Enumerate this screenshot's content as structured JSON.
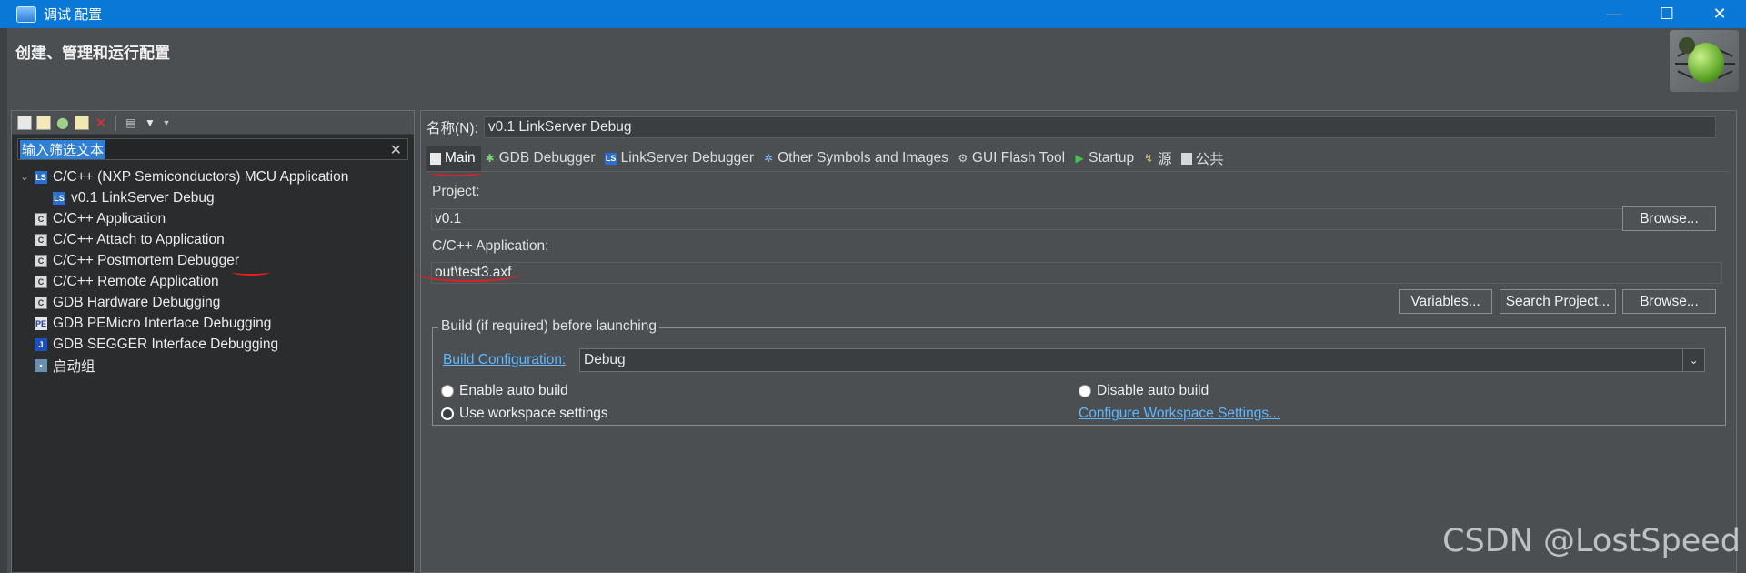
{
  "window": {
    "title": "调试 配置",
    "minimize_glyph": "—",
    "maximize_glyph": "☐",
    "close_glyph": "✕"
  },
  "header": {
    "subtitle": "创建、管理和运行配置"
  },
  "left_panel": {
    "toolbar": [
      "new-config-icon",
      "new-prototype-icon",
      "export-icon",
      "duplicate-icon",
      "delete-icon",
      "collapse-all-icon",
      "filter-icon",
      "dropdown-icon"
    ],
    "filter_value": "输入筛选文本",
    "tree": [
      {
        "label": "C/C++ (NXP Semiconductors) MCU Application",
        "icon": "LS",
        "expanded": true
      },
      {
        "label": "v0.1 LinkServer Debug",
        "icon": "LS",
        "child": true
      },
      {
        "label": "C/C++ Application",
        "icon": "C"
      },
      {
        "label": "C/C++ Attach to Application",
        "icon": "C"
      },
      {
        "label": "C/C++ Postmortem Debugger",
        "icon": "C"
      },
      {
        "label": "C/C++ Remote Application",
        "icon": "C"
      },
      {
        "label": "GDB Hardware Debugging",
        "icon": "C"
      },
      {
        "label": "GDB PEMicro Interface Debugging",
        "icon": "PE"
      },
      {
        "label": "GDB SEGGER Interface Debugging",
        "icon": "J"
      },
      {
        "label": "启动组",
        "icon": "group"
      }
    ]
  },
  "main": {
    "name_label": "名称(N):",
    "name_value": "v0.1 LinkServer Debug",
    "tabs": [
      {
        "label": "Main",
        "active": true
      },
      {
        "label": "GDB Debugger"
      },
      {
        "label": "LinkServer Debugger"
      },
      {
        "label": "Other Symbols and Images"
      },
      {
        "label": "GUI Flash Tool"
      },
      {
        "label": "Startup"
      },
      {
        "label": "源"
      },
      {
        "label": "公共"
      }
    ],
    "project_label": "Project:",
    "project_value": "v0.1",
    "browse_label": "Browse...",
    "app_label": "C/C++ Application:",
    "app_value": "out\\test3.axf",
    "variables_label": "Variables...",
    "search_project_label": "Search Project...",
    "browse2_label": "Browse...",
    "build_group_label": "Build (if required) before launching",
    "build_config_link": "Build Configuration:",
    "build_config_value": "Debug",
    "enable_auto_build": "Enable auto build",
    "disable_auto_build": "Disable auto build",
    "use_workspace": "Use workspace settings",
    "configure_workspace": "Configure Workspace Settings...",
    "selected_radio": "use_workspace"
  },
  "watermark": "CSDN @LostSpeed"
}
